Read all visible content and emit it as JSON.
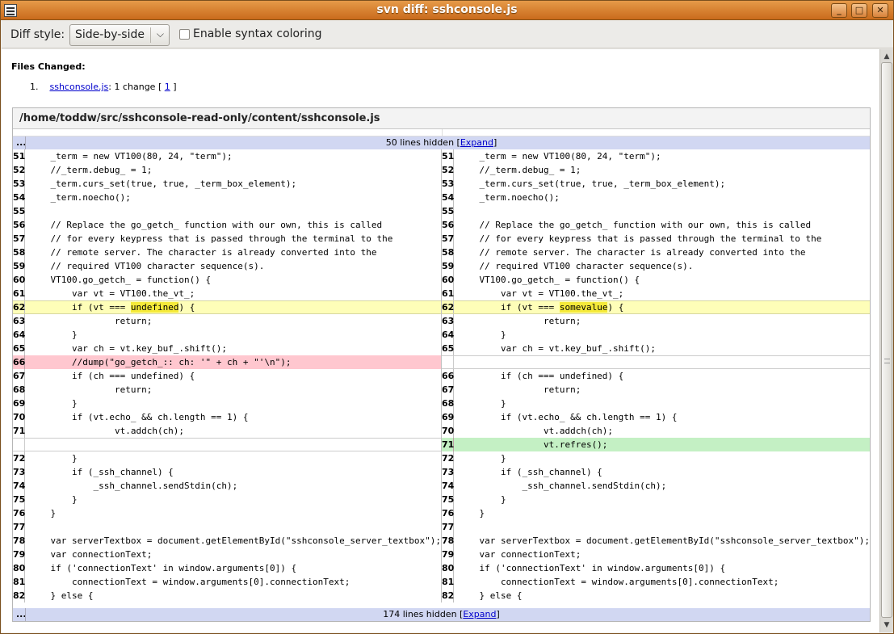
{
  "window": {
    "title": "svn diff: sshconsole.js"
  },
  "toolbar": {
    "diff_style_label": "Diff style:",
    "diff_style_value": "Side-by-side",
    "syntax_label": "Enable syntax coloring"
  },
  "files": {
    "title": "Files Changed:",
    "number": "1.",
    "file_link": "sshconsole.js",
    "change_text": ": 1 change [ ",
    "change_link": "1",
    "change_end": " ]"
  },
  "diff": {
    "path": "/home/toddw/src/sshconsole-read-only/content/sshconsole.js",
    "top_collapse": {
      "dots": "...",
      "text": "50 lines hidden [",
      "expand": "Expand",
      "end": "]"
    },
    "bottom_collapse": {
      "dots": "...",
      "text": "174 lines hidden [",
      "expand": "Expand",
      "end": "]"
    },
    "rows": [
      {
        "type": "same",
        "l": "51",
        "r": "51",
        "code": "    _term = new VT100(80, 24, \"term\");"
      },
      {
        "type": "same",
        "l": "52",
        "r": "52",
        "code": "    //_term.debug_ = 1;"
      },
      {
        "type": "same",
        "l": "53",
        "r": "53",
        "code": "    _term.curs_set(true, true, _term_box_element);"
      },
      {
        "type": "same",
        "l": "54",
        "r": "54",
        "code": "    _term.noecho();"
      },
      {
        "type": "same",
        "l": "55",
        "r": "55",
        "code": ""
      },
      {
        "type": "same",
        "l": "56",
        "r": "56",
        "code": "    // Replace the go_getch_ function with our own, this is called"
      },
      {
        "type": "same",
        "l": "57",
        "r": "57",
        "code": "    // for every keypress that is passed through the terminal to the"
      },
      {
        "type": "same",
        "l": "58",
        "r": "58",
        "code": "    // remote server. The character is already converted into the"
      },
      {
        "type": "same",
        "l": "59",
        "r": "59",
        "code": "    // required VT100 character sequence(s)."
      },
      {
        "type": "same",
        "l": "60",
        "r": "60",
        "code": "    VT100.go_getch_ = function() {"
      },
      {
        "type": "same",
        "l": "61",
        "r": "61",
        "code": "        var vt = VT100.the_vt_;"
      },
      {
        "type": "changed",
        "l": "62",
        "r": "62",
        "lpre": "        if (vt === ",
        "lhl": "undefined",
        "lpost": ") {",
        "rpre": "        if (vt === ",
        "rhl": "somevalue",
        "rpost": ") {"
      },
      {
        "type": "same",
        "l": "63",
        "r": "63",
        "code": "                return;"
      },
      {
        "type": "same",
        "l": "64",
        "r": "64",
        "code": "        }"
      },
      {
        "type": "same",
        "l": "65",
        "r": "65",
        "code": "        var ch = vt.key_buf_.shift();"
      },
      {
        "type": "del",
        "l": "66",
        "code": "        //dump(\"go_getch_:: ch: '\" + ch + \"'\\n\");"
      },
      {
        "type": "same",
        "l": "67",
        "r": "66",
        "code": "        if (ch === undefined) {"
      },
      {
        "type": "same",
        "l": "68",
        "r": "67",
        "code": "                return;"
      },
      {
        "type": "same",
        "l": "69",
        "r": "68",
        "code": "        }"
      },
      {
        "type": "same",
        "l": "70",
        "r": "69",
        "code": "        if (vt.echo_ && ch.length == 1) {"
      },
      {
        "type": "same",
        "l": "71",
        "r": "70",
        "code": "                vt.addch(ch);"
      },
      {
        "type": "ins",
        "r": "71",
        "code": "                vt.refres();"
      },
      {
        "type": "same",
        "l": "72",
        "r": "72",
        "code": "        }"
      },
      {
        "type": "same",
        "l": "73",
        "r": "73",
        "code": "        if (_ssh_channel) {"
      },
      {
        "type": "same",
        "l": "74",
        "r": "74",
        "code": "            _ssh_channel.sendStdin(ch);"
      },
      {
        "type": "same",
        "l": "75",
        "r": "75",
        "code": "        }"
      },
      {
        "type": "same",
        "l": "76",
        "r": "76",
        "code": "    }"
      },
      {
        "type": "same",
        "l": "77",
        "r": "77",
        "code": ""
      },
      {
        "type": "same",
        "l": "78",
        "r": "78",
        "code": "    var serverTextbox = document.getElementById(\"sshconsole_server_textbox\");"
      },
      {
        "type": "same",
        "l": "79",
        "r": "79",
        "code": "    var connectionText;"
      },
      {
        "type": "same",
        "l": "80",
        "r": "80",
        "code": "    if ('connectionText' in window.arguments[0]) {"
      },
      {
        "type": "same",
        "l": "81",
        "r": "81",
        "code": "        connectionText = window.arguments[0].connectionText;"
      },
      {
        "type": "same",
        "l": "82",
        "r": "82",
        "code": "    } else {"
      }
    ]
  }
}
